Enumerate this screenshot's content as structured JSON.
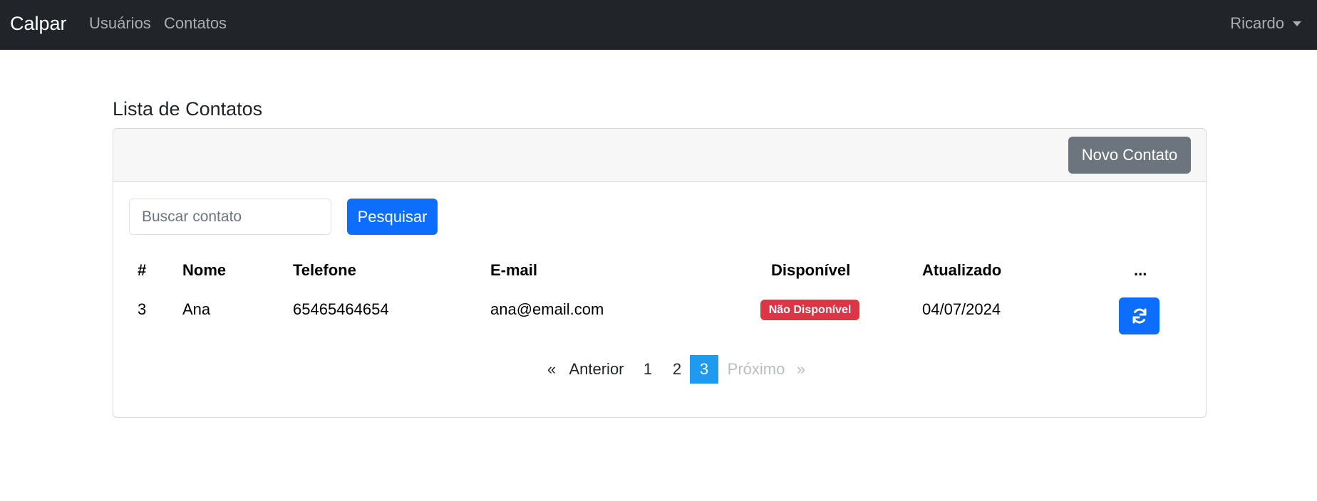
{
  "navbar": {
    "brand": "Calpar",
    "links": [
      "Usuários",
      "Contatos"
    ],
    "user": "Ricardo"
  },
  "page": {
    "title": "Lista de Contatos",
    "new_button": "Novo Contato",
    "search_placeholder": "Buscar contato",
    "search_value": "",
    "search_button": "Pesquisar"
  },
  "table": {
    "headers": [
      "#",
      "Nome",
      "Telefone",
      "E-mail",
      "Disponível",
      "Atualizado",
      "..."
    ],
    "rows": [
      {
        "id": "3",
        "name": "Ana",
        "phone": "65465464654",
        "email": "ana@email.com",
        "available": "Não Disponível",
        "updated": "04/07/2024",
        "action_icon": "refresh-icon"
      }
    ]
  },
  "pagination": {
    "prev_arrow": "«",
    "prev": "Anterior",
    "pages": [
      "1",
      "2",
      "3"
    ],
    "current": "3",
    "next": "Próximo",
    "next_arrow": "»"
  },
  "colors": {
    "navbar": "#212529",
    "primary": "#0d6efd",
    "secondary": "#6c757d",
    "danger": "#dc3545",
    "active_page": "#1e9bf0"
  }
}
